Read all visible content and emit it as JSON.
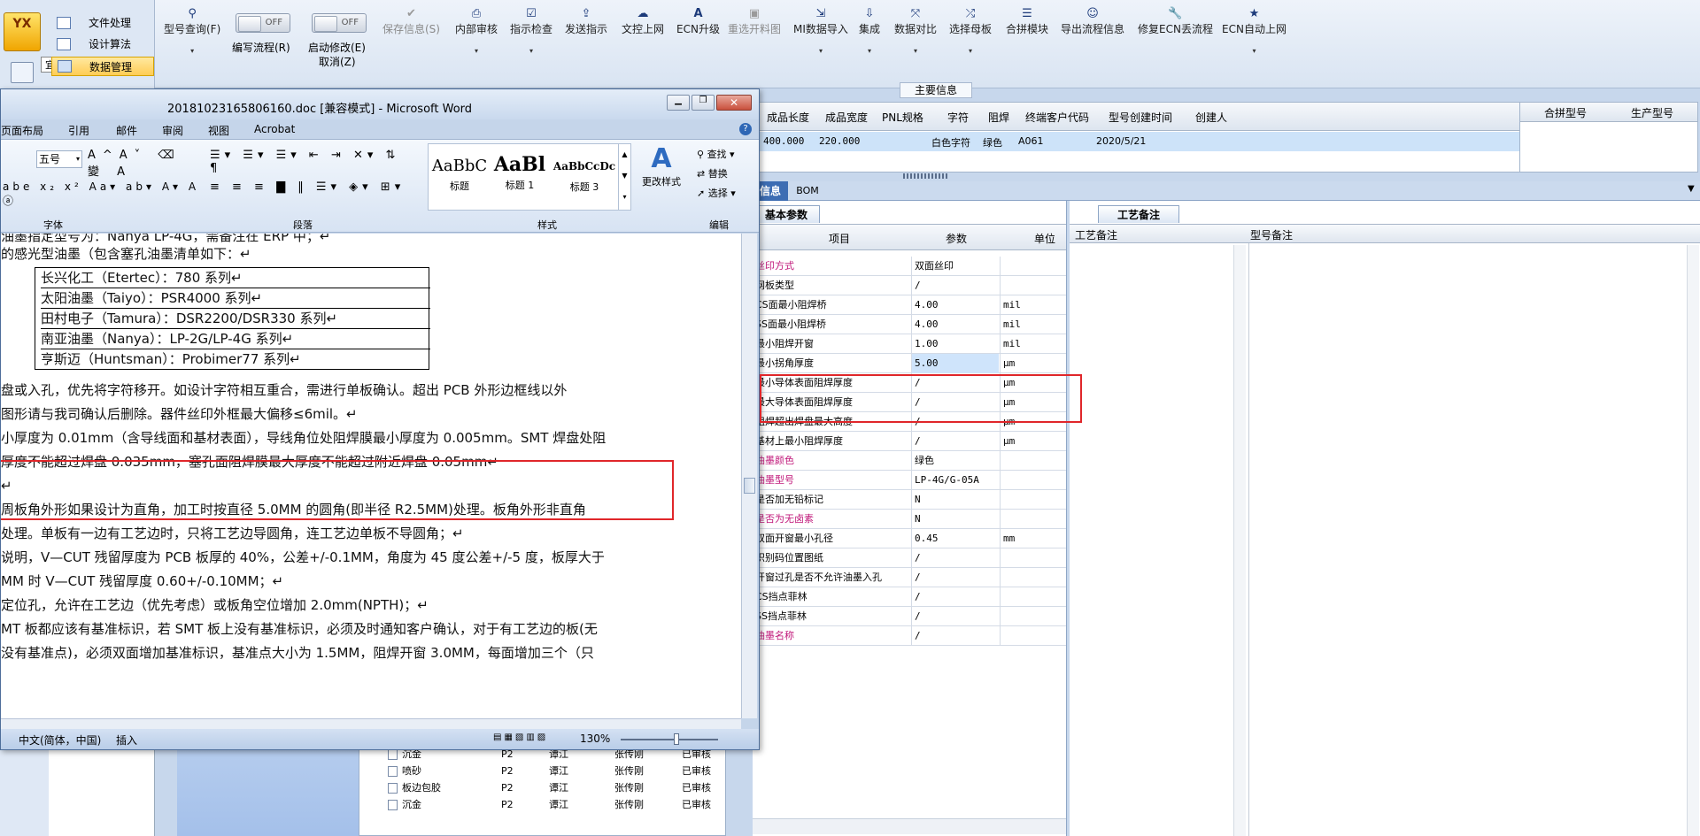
{
  "left_nav": {
    "items": [
      "文件处理",
      "设计算法",
      "数据管理"
    ],
    "logo": "YX",
    "tooltip": "宜兴"
  },
  "toolbar": {
    "buttons": [
      {
        "icon": "magnify",
        "label": "型号查询(F)",
        "drop": true
      },
      {
        "label": "编写流程(R)",
        "toggle": "OFF"
      },
      {
        "label": "启动修改(E)",
        "sub": "取消(Z)",
        "toggle": "OFF"
      },
      {
        "icon": "check",
        "label": "保存信息(S)",
        "disabled": true
      },
      {
        "icon": "print",
        "label": "内部审核",
        "drop": true
      },
      {
        "icon": "check",
        "label": "指示检查",
        "drop": true
      },
      {
        "icon": "up",
        "label": "发送指示"
      },
      {
        "icon": "cloud",
        "label": "文控上网"
      },
      {
        "icon": "A",
        "label": "ECN升级"
      },
      {
        "icon": "img",
        "label": "重选开料图",
        "disabled": true
      },
      {
        "icon": "import",
        "label": "MI数据导入",
        "drop": true
      },
      {
        "icon": "down",
        "label": "集成",
        "drop": true
      },
      {
        "icon": "compare",
        "label": "数据对比",
        "drop": true
      },
      {
        "icon": "shuffle",
        "label": "选择母板",
        "drop": true
      },
      {
        "icon": "list",
        "label": "合拼模块"
      },
      {
        "icon": "smile",
        "label": "导出流程信息"
      },
      {
        "icon": "wrench",
        "label": "修复ECN丢流程"
      },
      {
        "icon": "star",
        "label": "ECN自动上网",
        "drop": true
      }
    ],
    "section_label": "主要信息"
  },
  "info_grid": {
    "headers": [
      "成品长度",
      "成品宽度",
      "PNL规格",
      "字符",
      "阻焊",
      "终端客户代码",
      "型号创建时间",
      "创建人"
    ],
    "row": [
      "400.000",
      "220.000",
      "",
      "白色字符",
      "绿色",
      "A061",
      "2020/5/21",
      ""
    ],
    "right_headers": [
      "合拼型号",
      "生产型号"
    ]
  },
  "detail_tabs": {
    "tabs": [
      "信息",
      "BOM"
    ],
    "subtab": "基本参数",
    "right_tab": "工艺备注"
  },
  "param_grid": {
    "headers": [
      "项目",
      "参数",
      "单位"
    ],
    "rows": [
      {
        "item": "丝印方式",
        "value": "双面丝印",
        "unit": "",
        "pink": true
      },
      {
        "item": "网板类型",
        "value": "/",
        "unit": ""
      },
      {
        "item": "CS面最小阻焊桥",
        "value": "4.00",
        "unit": "mil"
      },
      {
        "item": "SS面最小阻焊桥",
        "value": "4.00",
        "unit": "mil"
      },
      {
        "item": "最小阻焊开窗",
        "value": "1.00",
        "unit": "mil"
      },
      {
        "item": "最小拐角厚度",
        "value": "5.00",
        "unit": "μm",
        "hl": true
      },
      {
        "item": "最小导体表面阻焊厚度",
        "value": "/",
        "unit": "μm"
      },
      {
        "item": "最大导体表面阻焊厚度",
        "value": "/",
        "unit": "μm"
      },
      {
        "item": "阻焊超出焊盘最大高度",
        "value": "/",
        "unit": "μm"
      },
      {
        "item": "基材上最小阻焊厚度",
        "value": "/",
        "unit": "μm"
      },
      {
        "item": "油墨颜色",
        "value": "绿色",
        "unit": "",
        "pink": true
      },
      {
        "item": "油墨型号",
        "value": "LP-4G/G-05A",
        "unit": "",
        "pink": true
      },
      {
        "item": "是否加无铅标记",
        "value": "N",
        "unit": ""
      },
      {
        "item": "是否为无卤素",
        "value": "N",
        "unit": "",
        "pink": true
      },
      {
        "item": "双面开窗最小孔径",
        "value": "0.45",
        "unit": "mm"
      },
      {
        "item": "识别码位置图纸",
        "value": "/",
        "unit": ""
      },
      {
        "item": "开窗过孔是否不允许油墨入孔",
        "value": "/",
        "unit": ""
      },
      {
        "item": "CS挡点菲林",
        "value": "/",
        "unit": ""
      },
      {
        "item": "SS挡点菲林",
        "value": "/",
        "unit": ""
      },
      {
        "item": "油墨名称",
        "value": "/",
        "unit": "",
        "pink": true
      }
    ]
  },
  "remarks": {
    "col1": "工艺备注",
    "col2": "型号备注"
  },
  "tree": {
    "rows": [
      {
        "name": "沉金",
        "c1": "P2",
        "c2": "谭江",
        "c3": "张传刚",
        "c4": "已审核"
      },
      {
        "name": "喷砂",
        "c1": "P2",
        "c2": "谭江",
        "c3": "张传刚",
        "c4": "已审核"
      },
      {
        "name": "板边包胶",
        "c1": "P2",
        "c2": "谭江",
        "c3": "张传刚",
        "c4": "已审核"
      },
      {
        "name": "沉金",
        "c1": "P2",
        "c2": "谭江",
        "c3": "张传刚",
        "c4": "已审核"
      }
    ]
  },
  "word": {
    "title": "20181023165806160.doc [兼容模式] - Microsoft Word",
    "tabs": [
      "页面布局",
      "引用",
      "邮件",
      "审阅",
      "视图",
      "Acrobat"
    ],
    "font_size": "五号",
    "groups": [
      "字体",
      "段落",
      "样式",
      "编辑"
    ],
    "styles": [
      {
        "sample": "AaBbC",
        "name": "标题"
      },
      {
        "sample": "AaBl",
        "name": "标题 1"
      },
      {
        "sample": "AaBbCcDc",
        "name": "标题 3"
      }
    ],
    "change_style": "更改样式",
    "edit": [
      "查找 ▾",
      "替换",
      "选择 ▾"
    ],
    "lines": [
      "油墨指定型号为：Nanya LP-4G，需备注在 ERP 中；↵",
      "的感光型油墨（包含塞孔油墨清单如下：↵"
    ],
    "table": [
      "长兴化工（Etertec）：780 系列↵",
      "太阳油墨（Taiyo）：PSR4000 系列↵",
      "田村电子（Tamura）：DSR2200/DSR330 系列↵",
      "南亚油墨（Nanya）：LP-2G/LP-4G 系列↵",
      "亨斯迈（Huntsman）：Probimer77 系列↵"
    ],
    "body": [
      "盘或入孔，优先将字符移开。如设计字符相互重合，需进行单板确认。超出 PCB 外形边框线以外",
      "图形请与我司确认后删除。器件丝印外框最大偏移≤6mil。↵",
      "小厚度为 0.01mm（含导线面和基材表面），导线角位处阻焊膜最小厚度为 0.005mm。SMT 焊盘处阻",
      "厚度不能超过焊盘 0.035mm，塞孔面阻焊膜最大厚度不能超过附近焊盘 0.05mm↵",
      "↵",
      "周板角外形如果设计为直角，加工时按直径 5.0MM 的圆角(即半径 R2.5MM)处理。板角外形非直角",
      "处理。单板有一边有工艺边时，只将工艺边导圆角，连工艺边单板不导圆角；↵",
      "说明，V—CUT 残留厚度为 PCB 板厚的 40%，公差+/-0.1MM，角度为 45 度公差+/-5 度，板厚大于",
      "MM 时 V—CUT 残留厚度 0.60+/-0.10MM；↵",
      "定位孔，允许在工艺边（优先考虑）或板角空位增加 2.0mm(NPTH)；↵",
      "MT 板都应该有基准标识，若 SMT 板上没有基准标识，必须及时通知客户确认，对于有工艺边的板(无",
      "没有基准点)，必须双面增加基准标识，基准点大小为 1.5MM，阻焊开窗 3.0MM，每面增加三个（只"
    ],
    "status": {
      "lang": "中文(简体，中国)",
      "mode": "插入",
      "zoom": "130%"
    }
  }
}
